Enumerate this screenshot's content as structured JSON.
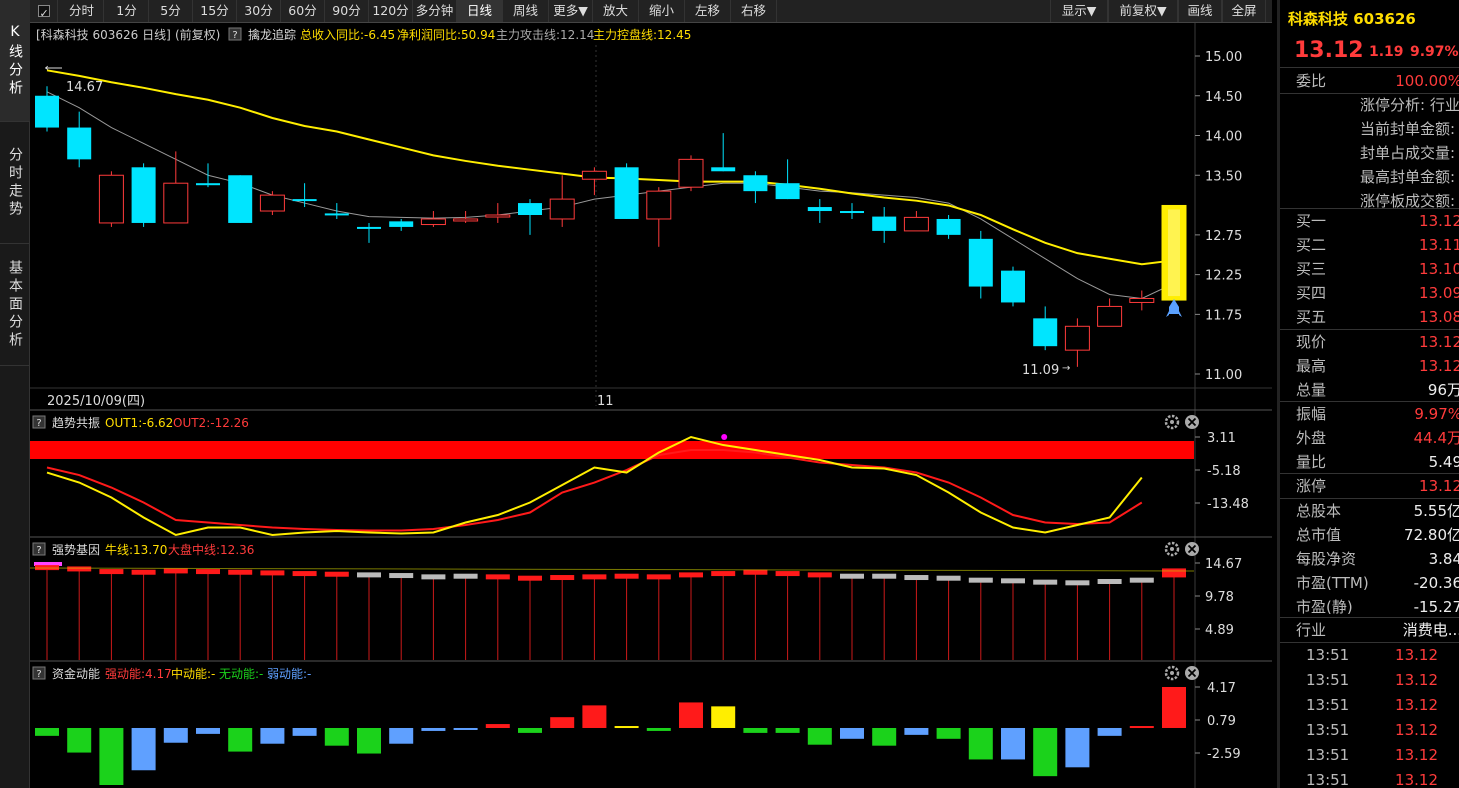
{
  "toolbar": {
    "tabs": [
      {
        "label": "分时"
      },
      {
        "label": "1分"
      },
      {
        "label": "5分"
      },
      {
        "label": "15分"
      },
      {
        "label": "30分"
      },
      {
        "label": "60分"
      },
      {
        "label": "90分"
      },
      {
        "label": "120分"
      },
      {
        "label": "多分钟"
      },
      {
        "label": "日线"
      },
      {
        "label": "周线"
      },
      {
        "label": "更多▼"
      },
      {
        "label": "放大"
      },
      {
        "label": "缩小"
      },
      {
        "label": "左移"
      },
      {
        "label": "右移"
      }
    ],
    "right": [
      {
        "label": "显示▼"
      },
      {
        "label": "前复权▼"
      },
      {
        "label": "画线"
      },
      {
        "label": "全屏"
      }
    ]
  },
  "leftbar": [
    {
      "label": "K线分析"
    },
    {
      "label": "分时走势"
    },
    {
      "label": "基本面分析"
    }
  ],
  "main_chart": {
    "header_stock": "[科森科技 603626 日线]",
    "header_adj": "(前复权)",
    "indicator_name": "擒龙追踪",
    "items": [
      {
        "text": "总收入同比:-6.45",
        "color": "#ffdd00"
      },
      {
        "text": "净利润同比:50.94",
        "color": "#ffdd00"
      },
      {
        "text": "主力攻击线:12.14",
        "color": "#aaaaaa"
      },
      {
        "text": "主力控盘线:12.45",
        "color": "#ffdd00"
      }
    ],
    "y_ticks": [
      "15.00",
      "14.50",
      "14.00",
      "13.50",
      "12.75",
      "12.25",
      "11.75",
      "11.00"
    ],
    "high_label": "14.67",
    "low_label": "11.09",
    "date_label": "2025/10/09(四)",
    "month_label": "11"
  },
  "chart_data": {
    "type": "candlestick",
    "candles": [
      {
        "o": 14.5,
        "c": 14.1,
        "h": 14.62,
        "l": 14.05,
        "up": false
      },
      {
        "o": 14.1,
        "c": 13.7,
        "h": 14.3,
        "l": 13.6,
        "up": false
      },
      {
        "o": 12.9,
        "c": 13.5,
        "h": 13.55,
        "l": 12.85,
        "up": true
      },
      {
        "o": 13.6,
        "c": 12.9,
        "h": 13.65,
        "l": 12.85,
        "up": false
      },
      {
        "o": 12.9,
        "c": 13.4,
        "h": 13.8,
        "l": 12.9,
        "up": true
      },
      {
        "o": 13.4,
        "c": 13.4,
        "h": 13.65,
        "l": 13.35,
        "up": false
      },
      {
        "o": 13.5,
        "c": 12.9,
        "h": 13.5,
        "l": 12.9,
        "up": false
      },
      {
        "o": 13.05,
        "c": 13.25,
        "h": 13.3,
        "l": 13.0,
        "up": true
      },
      {
        "o": 13.2,
        "c": 13.2,
        "h": 13.4,
        "l": 13.1,
        "up": false
      },
      {
        "o": 13.02,
        "c": 13.02,
        "h": 13.15,
        "l": 12.95,
        "up": false
      },
      {
        "o": 12.85,
        "c": 12.85,
        "h": 12.9,
        "l": 12.65,
        "up": false
      },
      {
        "o": 12.92,
        "c": 12.85,
        "h": 12.95,
        "l": 12.8,
        "up": false
      },
      {
        "o": 12.88,
        "c": 12.95,
        "h": 13.05,
        "l": 12.85,
        "up": true
      },
      {
        "o": 12.95,
        "c": 12.95,
        "h": 13.05,
        "l": 12.9,
        "up": true
      },
      {
        "o": 12.98,
        "c": 13.0,
        "h": 13.15,
        "l": 12.9,
        "up": true
      },
      {
        "o": 13.0,
        "c": 13.15,
        "h": 13.2,
        "l": 12.75,
        "up": false
      },
      {
        "o": 12.95,
        "c": 13.2,
        "h": 13.5,
        "l": 12.85,
        "up": true
      },
      {
        "o": 13.45,
        "c": 13.55,
        "h": 13.6,
        "l": 13.25,
        "up": true
      },
      {
        "o": 13.6,
        "c": 12.95,
        "h": 13.65,
        "l": 12.95,
        "up": false
      },
      {
        "o": 12.95,
        "c": 13.3,
        "h": 13.35,
        "l": 12.6,
        "up": true
      },
      {
        "o": 13.35,
        "c": 13.7,
        "h": 13.75,
        "l": 13.3,
        "up": true
      },
      {
        "o": 13.6,
        "c": 13.55,
        "h": 14.03,
        "l": 13.55,
        "up": false
      },
      {
        "o": 13.5,
        "c": 13.3,
        "h": 13.55,
        "l": 13.15,
        "up": false
      },
      {
        "o": 13.4,
        "c": 13.2,
        "h": 13.7,
        "l": 13.2,
        "up": false
      },
      {
        "o": 13.1,
        "c": 13.05,
        "h": 13.2,
        "l": 12.9,
        "up": false
      },
      {
        "o": 13.05,
        "c": 13.05,
        "h": 13.15,
        "l": 12.95,
        "up": false
      },
      {
        "o": 12.98,
        "c": 12.8,
        "h": 13.1,
        "l": 12.65,
        "up": false
      },
      {
        "o": 12.8,
        "c": 12.97,
        "h": 13.05,
        "l": 12.8,
        "up": true
      },
      {
        "o": 12.95,
        "c": 12.75,
        "h": 13.0,
        "l": 12.7,
        "up": false
      },
      {
        "o": 12.7,
        "c": 12.1,
        "h": 12.8,
        "l": 11.95,
        "up": false
      },
      {
        "o": 12.3,
        "c": 11.9,
        "h": 12.35,
        "l": 11.85,
        "up": false
      },
      {
        "o": 11.7,
        "c": 11.35,
        "h": 11.85,
        "l": 11.3,
        "up": false
      },
      {
        "o": 11.3,
        "c": 11.6,
        "h": 11.7,
        "l": 11.09,
        "up": true
      },
      {
        "o": 11.6,
        "c": 11.85,
        "h": 11.95,
        "l": 11.6,
        "up": true
      },
      {
        "o": 11.9,
        "c": 11.95,
        "h": 12.05,
        "l": 11.8,
        "up": true
      },
      {
        "o": 11.93,
        "c": 13.12,
        "h": 13.12,
        "l": 11.93,
        "up": true
      }
    ],
    "ma_yellow": [
      14.82,
      14.75,
      14.67,
      14.6,
      14.52,
      14.45,
      14.35,
      14.22,
      14.12,
      14.05,
      13.95,
      13.85,
      13.75,
      13.68,
      13.62,
      13.57,
      13.52,
      13.47,
      13.46,
      13.44,
      13.42,
      13.42,
      13.42,
      13.38,
      13.33,
      13.27,
      13.22,
      13.18,
      13.12,
      13.0,
      12.82,
      12.65,
      12.52,
      12.45,
      12.38,
      12.43
    ],
    "ma_grey": [
      14.55,
      14.35,
      14.1,
      13.9,
      13.7,
      13.5,
      13.4,
      13.25,
      13.15,
      13.05,
      12.98,
      12.97,
      12.96,
      12.97,
      13.0,
      13.05,
      13.1,
      13.2,
      13.25,
      13.3,
      13.35,
      13.4,
      13.4,
      13.35,
      13.3,
      13.28,
      13.25,
      13.22,
      13.15,
      12.95,
      12.7,
      12.45,
      12.2,
      12.0,
      11.95,
      12.14
    ]
  },
  "panel2": {
    "name": "趋势共振",
    "out1": "OUT1:-6.62",
    "out2": "OUT2:-12.26",
    "y_ticks": [
      "3.11",
      "-5.18",
      "-13.48"
    ],
    "yellow": [
      -4,
      -6,
      -9,
      -13,
      -16.5,
      -15,
      -15,
      -16.5,
      -16,
      -15.7,
      -16,
      -16.2,
      -16,
      -14,
      -12.5,
      -10,
      -6.5,
      -3,
      -4,
      0,
      3.11,
      1.5,
      0.5,
      -0.5,
      -1.5,
      -3,
      -3.2,
      -4.5,
      -8,
      -12,
      -15,
      -16,
      -14.5,
      -13,
      -5
    ],
    "red": [
      -3,
      -4.5,
      -7,
      -10,
      -13.5,
      -14,
      -14.5,
      -15,
      -15.3,
      -15.5,
      -15.6,
      -15.6,
      -15.3,
      -14.5,
      -13.5,
      -12,
      -8,
      -6,
      -3.5,
      -0.5,
      0.5,
      0.5,
      0,
      -1,
      -2,
      -2.5,
      -3,
      -4,
      -6,
      -9,
      -12.5,
      -14,
      -14.3,
      -14,
      -10
    ]
  },
  "panel3": {
    "name": "强势基因",
    "bull": "牛线:13.70",
    "mid": "大盘中线:12.36",
    "y_ticks": [
      "14.67",
      "9.78",
      "4.89"
    ],
    "bars": [
      14.2,
      14.0,
      13.6,
      13.5,
      13.7,
      13.6,
      13.5,
      13.4,
      13.3,
      13.2,
      13.1,
      13.0,
      12.8,
      12.9,
      12.8,
      12.6,
      12.7,
      12.8,
      12.9,
      12.8,
      13.1,
      13.3,
      13.5,
      13.3,
      13.1,
      12.9,
      12.9,
      12.7,
      12.6,
      12.3,
      12.2,
      12.0,
      11.9,
      12.1,
      12.3,
      13.7
    ],
    "bar_red": [
      true,
      true,
      true,
      true,
      true,
      true,
      true,
      true,
      true,
      true,
      false,
      false,
      false,
      false,
      true,
      true,
      true,
      true,
      true,
      true,
      true,
      true,
      true,
      true,
      true,
      false,
      false,
      false,
      false,
      false,
      false,
      false,
      false,
      false,
      false,
      true
    ]
  },
  "panel4": {
    "name": "资金动能",
    "strong": "强动能:4.17",
    "mid": "中动能:-",
    "none": "无动能:-",
    "weak": "弱动能:-",
    "y_ticks": [
      "4.17",
      "0.79",
      "-2.59"
    ],
    "bars": [
      -0.8,
      -2.5,
      -5.8,
      -4.3,
      -1.5,
      -0.6,
      -2.4,
      -1.6,
      -0.8,
      -1.8,
      -2.6,
      -1.6,
      -0.3,
      -0.2,
      0.4,
      -0.5,
      1.1,
      2.3,
      0.2,
      -0.3,
      2.6,
      2.2,
      -0.5,
      -0.5,
      -1.7,
      -1.1,
      -1.8,
      -0.7,
      -1.1,
      -3.2,
      -3.2,
      -4.9,
      -4.0,
      -0.8,
      0.2,
      4.17
    ],
    "bar_color": [
      "#1bd21b",
      "#1bd21b",
      "#1bd21b",
      "#5fa0ff",
      "#5fa0ff",
      "#5fa0ff",
      "#1bd21b",
      "#5fa0ff",
      "#5fa0ff",
      "#1bd21b",
      "#1bd21b",
      "#5fa0ff",
      "#5fa0ff",
      "#5fa0ff",
      "#ff1a1a",
      "#1bd21b",
      "#ff1a1a",
      "#ff1a1a",
      "#ffee00",
      "#1bd21b",
      "#ff1a1a",
      "#ffee00",
      "#1bd21b",
      "#1bd21b",
      "#1bd21b",
      "#5fa0ff",
      "#1bd21b",
      "#5fa0ff",
      "#1bd21b",
      "#1bd21b",
      "#5fa0ff",
      "#1bd21b",
      "#5fa0ff",
      "#5fa0ff",
      "#ff1a1a",
      "#ff1a1a"
    ]
  },
  "right_panel": {
    "title": "科森科技 603626",
    "price": "13.12",
    "change": "1.19",
    "pct": "9.97%",
    "weibi": {
      "k": "委比",
      "v": "100.00%"
    },
    "limit_rows": [
      "涨停分析: 行业",
      "当前封单金额:",
      "封单占成交量:",
      "最高封单金额:",
      "涨停板成交额:"
    ],
    "bids": [
      {
        "k": "买一",
        "v": "13.12"
      },
      {
        "k": "买二",
        "v": "13.11"
      },
      {
        "k": "买三",
        "v": "13.10"
      },
      {
        "k": "买四",
        "v": "13.09"
      },
      {
        "k": "买五",
        "v": "13.08"
      }
    ],
    "quote": [
      {
        "k": "现价",
        "v": "13.12",
        "c": "red"
      },
      {
        "k": "最高",
        "v": "13.12",
        "c": "red"
      },
      {
        "k": "总量",
        "v": "96万",
        "c": "wht"
      }
    ],
    "quote2": [
      {
        "k": "振幅",
        "v": "9.97%",
        "c": "red"
      },
      {
        "k": "外盘",
        "v": "44.4万",
        "c": "red"
      },
      {
        "k": "量比",
        "v": "5.49",
        "c": "wht"
      }
    ],
    "zt": {
      "k": "涨停",
      "v": "13.12"
    },
    "fund": [
      {
        "k": "总股本",
        "v": "5.55亿"
      },
      {
        "k": "总市值",
        "v": "72.80亿"
      },
      {
        "k": "每股净资",
        "v": "3.84"
      },
      {
        "k": "市盈(TTM)",
        "v": "-20.36"
      },
      {
        "k": "市盈(静)",
        "v": "-15.27"
      }
    ],
    "industry": {
      "k": "行业",
      "v": "消费电..."
    },
    "ticks": [
      {
        "t": "13:51",
        "p": "13.12"
      },
      {
        "t": "13:51",
        "p": "13.12"
      },
      {
        "t": "13:51",
        "p": "13.12"
      },
      {
        "t": "13:51",
        "p": "13.12"
      },
      {
        "t": "13:51",
        "p": "13.12"
      },
      {
        "t": "13:51",
        "p": "13.12"
      }
    ]
  }
}
